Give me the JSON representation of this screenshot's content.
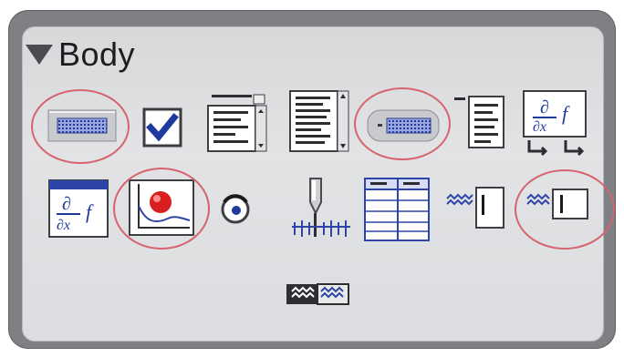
{
  "panel": {
    "title": "Body"
  },
  "palette_items": [
    {
      "name": "bar-control-icon",
      "highlighted": true
    },
    {
      "name": "checkbox-icon",
      "highlighted": false
    },
    {
      "name": "listbox-icon",
      "highlighted": false
    },
    {
      "name": "list-with-scroll-icon",
      "highlighted": false
    },
    {
      "name": "rounded-bar-control-icon",
      "highlighted": true
    },
    {
      "name": "numbered-list-icon",
      "highlighted": false
    },
    {
      "name": "formula-editor-icon",
      "highlighted": false
    },
    {
      "name": "formula-window-icon",
      "highlighted": false
    },
    {
      "name": "plot-point-icon",
      "highlighted": true
    },
    {
      "name": "radio-button-icon",
      "highlighted": false
    },
    {
      "name": "slider-icon",
      "highlighted": false
    },
    {
      "name": "table-grid-icon",
      "highlighted": false
    },
    {
      "name": "labeled-input-icon",
      "highlighted": false
    },
    {
      "name": "labeled-textbox-icon",
      "highlighted": true
    },
    {
      "name": "wave-toggle-icon",
      "highlighted": false
    }
  ],
  "highlight_color": "#d6636f",
  "accent_blue": "#2e45a8"
}
